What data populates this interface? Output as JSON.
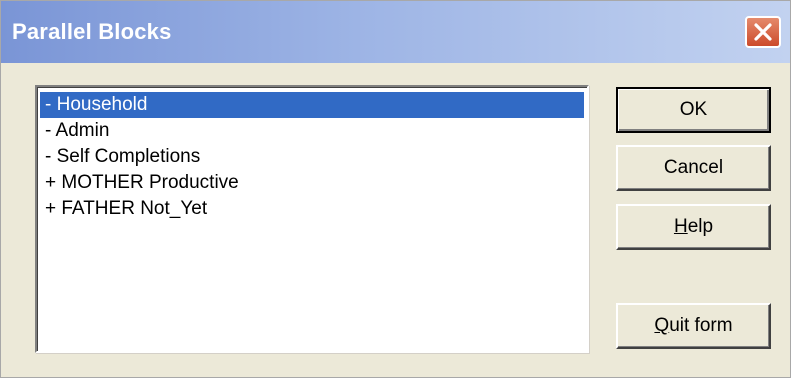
{
  "window": {
    "title": "Parallel Blocks",
    "close_icon": "close-icon"
  },
  "list": {
    "items": [
      {
        "label": "- Household",
        "selected": true
      },
      {
        "label": "- Admin",
        "selected": false
      },
      {
        "label": "- Self Completions",
        "selected": false
      },
      {
        "label": "+ MOTHER Productive",
        "selected": false
      },
      {
        "label": "+ FATHER Not_Yet",
        "selected": false
      }
    ]
  },
  "buttons": {
    "ok": "OK",
    "cancel": "Cancel",
    "help_mnemonic": "H",
    "help_rest": "elp",
    "quit_mnemonic": "Q",
    "quit_rest": "uit form"
  },
  "colors": {
    "selection": "#316ac5",
    "title_gradient_start": "#7a95d6",
    "title_gradient_end": "#c2d2f0",
    "close_button": "#cc4b2b",
    "dialog_face": "#ece9d8"
  }
}
